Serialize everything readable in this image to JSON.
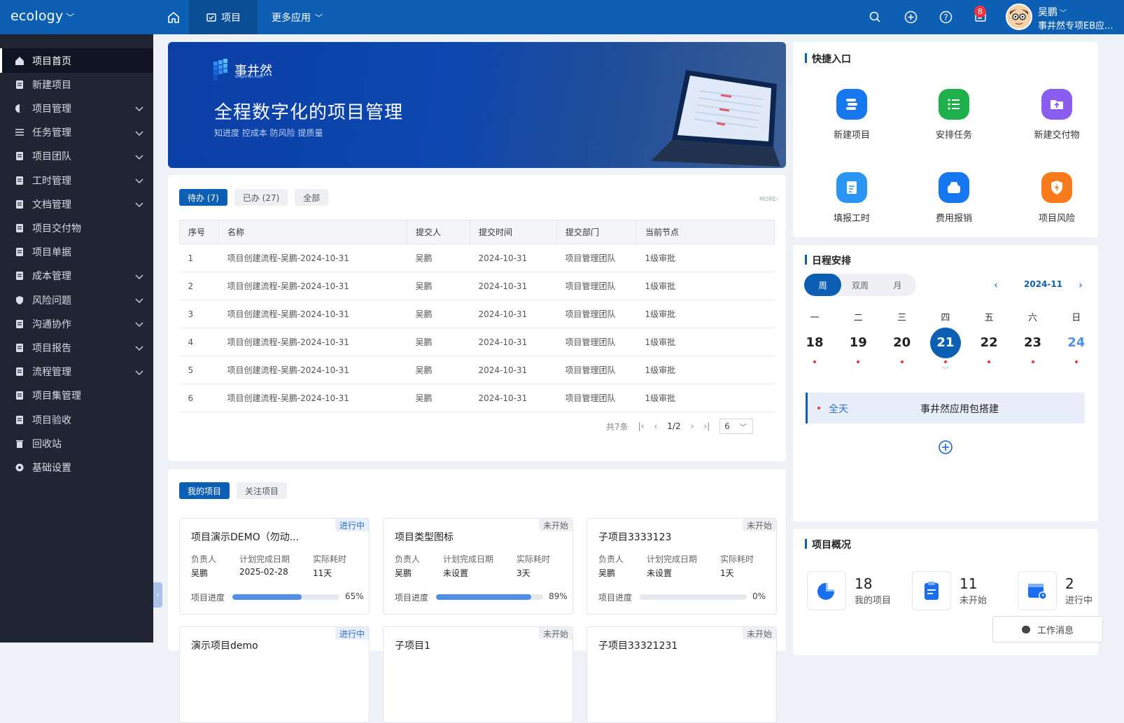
{
  "topbar": {
    "brand": "ecology",
    "nav_project": "项目",
    "nav_more": "更多应用",
    "notification_count": "8",
    "user_name": "吴鹏",
    "user_org": "事井然专项EB应..."
  },
  "sidebar": {
    "items": [
      {
        "label": "项目首页",
        "icon": "home-icon",
        "expand": false
      },
      {
        "label": "新建项目",
        "icon": "new-doc-icon",
        "expand": false
      },
      {
        "label": "项目管理",
        "icon": "circle-half-icon",
        "expand": true
      },
      {
        "label": "任务管理",
        "icon": "list-icon",
        "expand": true
      },
      {
        "label": "项目团队",
        "icon": "team-icon",
        "expand": true
      },
      {
        "label": "工时管理",
        "icon": "timesheet-icon",
        "expand": true
      },
      {
        "label": "文档管理",
        "icon": "docs-icon",
        "expand": true
      },
      {
        "label": "项目交付物",
        "icon": "deliverable-icon",
        "expand": false
      },
      {
        "label": "项目单据",
        "icon": "receipt-icon",
        "expand": false
      },
      {
        "label": "成本管理",
        "icon": "cost-icon",
        "expand": true
      },
      {
        "label": "风险问题",
        "icon": "shield-icon",
        "expand": true
      },
      {
        "label": "沟通协作",
        "icon": "handshake-icon",
        "expand": true
      },
      {
        "label": "项目报告",
        "icon": "report-icon",
        "expand": true
      },
      {
        "label": "流程管理",
        "icon": "flow-icon",
        "expand": true
      },
      {
        "label": "项目集管理",
        "icon": "layers-icon",
        "expand": false
      },
      {
        "label": "项目验收",
        "icon": "check-doc-icon",
        "expand": false
      },
      {
        "label": "回收站",
        "icon": "trash-icon",
        "expand": false
      },
      {
        "label": "基础设置",
        "icon": "gear-icon",
        "expand": false
      }
    ]
  },
  "banner": {
    "logo_text": "事井然",
    "logo_sub": "shijinran.com",
    "title": "全程数字化的项目管理",
    "subtitle": "知进度 控成本 防风险 提质量"
  },
  "todo": {
    "tabs": [
      "待办 (7)",
      "已办 (27)",
      "全部"
    ],
    "more": "MORE",
    "columns": [
      "序号",
      "名称",
      "提交人",
      "提交时间",
      "提交部门",
      "当前节点"
    ],
    "rows": [
      [
        "1",
        "项目创建流程-吴鹏-2024-10-31",
        "吴鹏",
        "2024-10-31",
        "项目管理团队",
        "1级审批"
      ],
      [
        "2",
        "项目创建流程-吴鹏-2024-10-31",
        "吴鹏",
        "2024-10-31",
        "项目管理团队",
        "1级审批"
      ],
      [
        "3",
        "项目创建流程-吴鹏-2024-10-31",
        "吴鹏",
        "2024-10-31",
        "项目管理团队",
        "1级审批"
      ],
      [
        "4",
        "项目创建流程-吴鹏-2024-10-31",
        "吴鹏",
        "2024-10-31",
        "项目管理团队",
        "1级审批"
      ],
      [
        "5",
        "项目创建流程-吴鹏-2024-10-31",
        "吴鹏",
        "2024-10-31",
        "项目管理团队",
        "1级审批"
      ],
      [
        "6",
        "项目创建流程-吴鹏-2024-10-31",
        "吴鹏",
        "2024-10-31",
        "项目管理团队",
        "1级审批"
      ]
    ],
    "pager": {
      "total": "共7条",
      "page": "1/2",
      "size": "6"
    }
  },
  "projects": {
    "tabs": [
      "我的项目",
      "关注项目"
    ],
    "labels": {
      "owner": "负责人",
      "plan": "计划完成日期",
      "cost": "实际耗时",
      "progress": "项目进度"
    },
    "cards": [
      {
        "name": "项目演示DEMO（勿动...",
        "status": "进行中",
        "owner": "吴鹏",
        "plan": "2025-02-28",
        "cost": "11天",
        "progress": "65%",
        "progress_value": 0.65
      },
      {
        "name": "项目类型图标",
        "status": "未开始",
        "owner": "吴鹏",
        "plan": "未设置",
        "cost": "3天",
        "progress": "89%",
        "progress_value": 0.89
      },
      {
        "name": "子项目3333123",
        "status": "未开始",
        "owner": "吴鹏",
        "plan": "未设置",
        "cost": "1天",
        "progress": "0%",
        "progress_value": 0
      },
      {
        "name": "演示项目demo",
        "status": "进行中"
      },
      {
        "name": "子项目1",
        "status": "未开始"
      },
      {
        "name": "子项目33321231",
        "status": "未开始"
      }
    ]
  },
  "quick": {
    "title": "快捷入口",
    "items": [
      {
        "label": "新建项目",
        "icon": "new-project-icon",
        "color": "#1677f0"
      },
      {
        "label": "安排任务",
        "icon": "task-list-icon",
        "color": "#1fb04c"
      },
      {
        "label": "新建交付物",
        "icon": "upload-folder-icon",
        "color": "#8b5cf0"
      },
      {
        "label": "填报工时",
        "icon": "timesheet-doc-icon",
        "color": "#2b95f5"
      },
      {
        "label": "费用报销",
        "icon": "wallet-icon",
        "color": "#1677f0"
      },
      {
        "label": "项目风险",
        "icon": "risk-shield-icon",
        "color": "#f97a1a"
      }
    ]
  },
  "schedule": {
    "title": "日程安排",
    "views": [
      "周",
      "双周",
      "月"
    ],
    "month": "2024-11",
    "weekdays": [
      "一",
      "二",
      "三",
      "四",
      "五",
      "六",
      "日"
    ],
    "days": [
      "18",
      "19",
      "20",
      "21",
      "22",
      "23",
      "24"
    ],
    "event": {
      "time": "全天",
      "title": "事井然应用包搭建"
    }
  },
  "overview": {
    "title": "项目概况",
    "items": [
      {
        "num": "18",
        "label": "我的项目",
        "icon": "pie-icon"
      },
      {
        "num": "11",
        "label": "未开始",
        "icon": "clipboard-icon"
      },
      {
        "num": "2",
        "label": "进行中",
        "icon": "calendar-clock-icon"
      }
    ]
  },
  "message_button": "工作消息"
}
